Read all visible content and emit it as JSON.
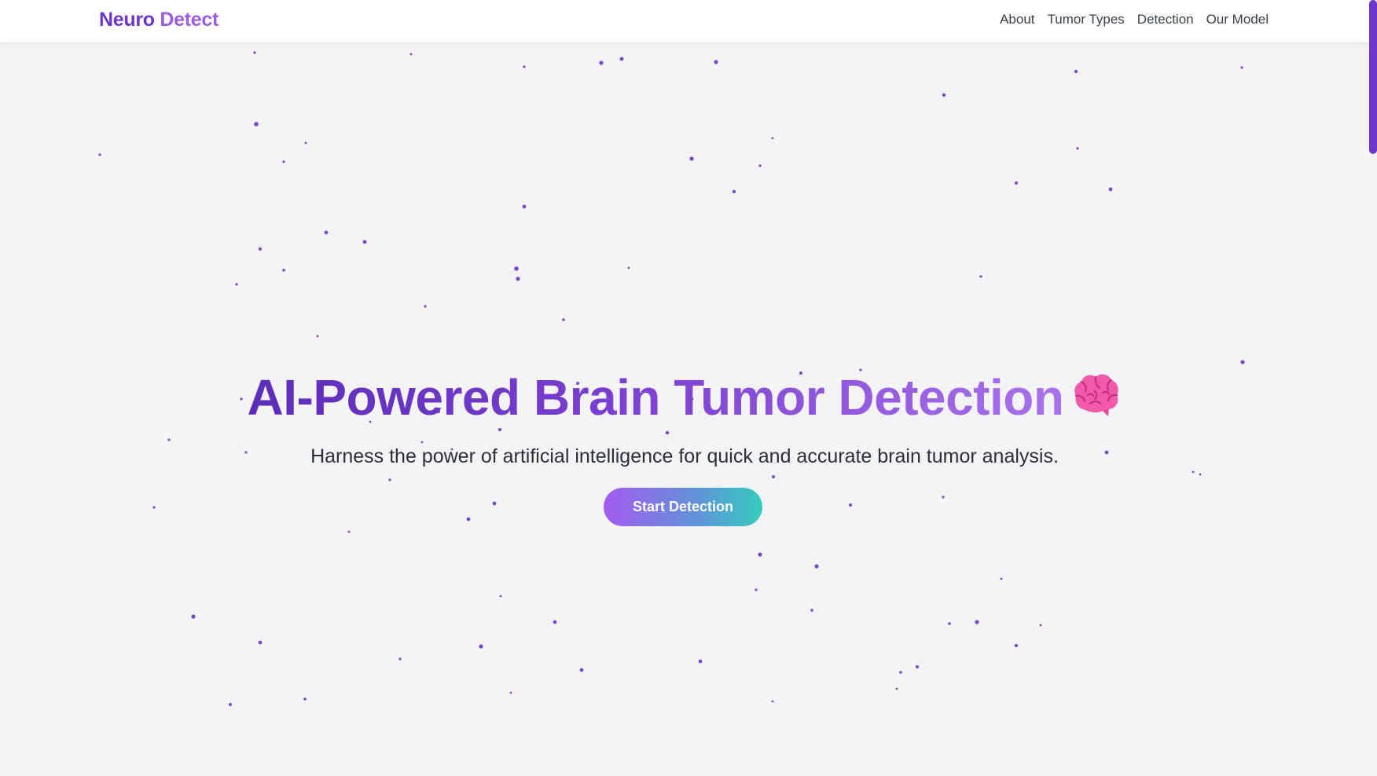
{
  "header": {
    "brand_first": "Neuro",
    "brand_second": "Detect",
    "nav": [
      "About",
      "Tumor Types",
      "Detection",
      "Our Model"
    ]
  },
  "hero": {
    "title": "AI-Powered Brain Tumor Detection",
    "title_icon": "brain-icon",
    "subtitle": "Harness the power of artificial intelligence for quick and accurate brain tumor analysis.",
    "cta_label": "Start Detection"
  },
  "colors": {
    "brand": "#6d35c9",
    "brand_light": "#9b5ce0",
    "particle": "#7b45d0",
    "background": "#f3f4f6",
    "cta_gradient": [
      "#a35bf0",
      "#5e95d8",
      "#34cdbd"
    ]
  }
}
